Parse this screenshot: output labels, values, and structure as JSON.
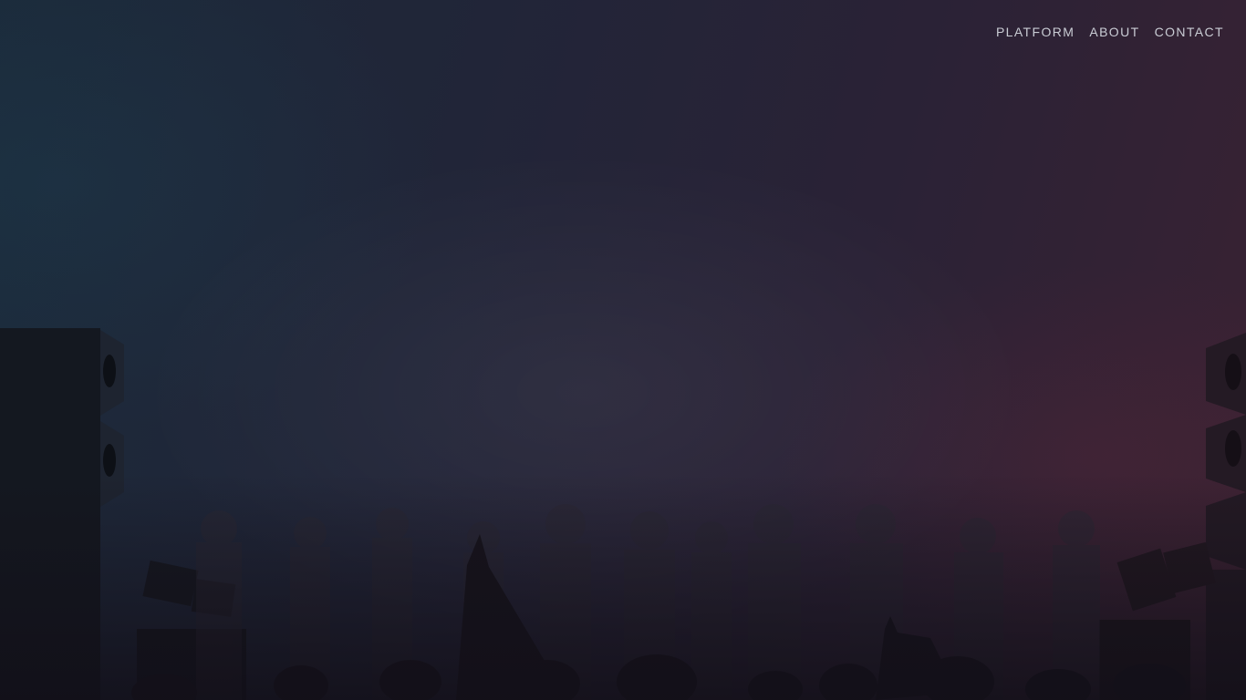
{
  "nav": {
    "items": [
      {
        "label": "PLATFORM"
      },
      {
        "label": "ABOUT"
      },
      {
        "label": "CONTACT"
      }
    ]
  },
  "colors": {
    "background_left": "#1b2a3a",
    "background_right": "#3a2232",
    "nav_text": "#c9ccd4"
  }
}
